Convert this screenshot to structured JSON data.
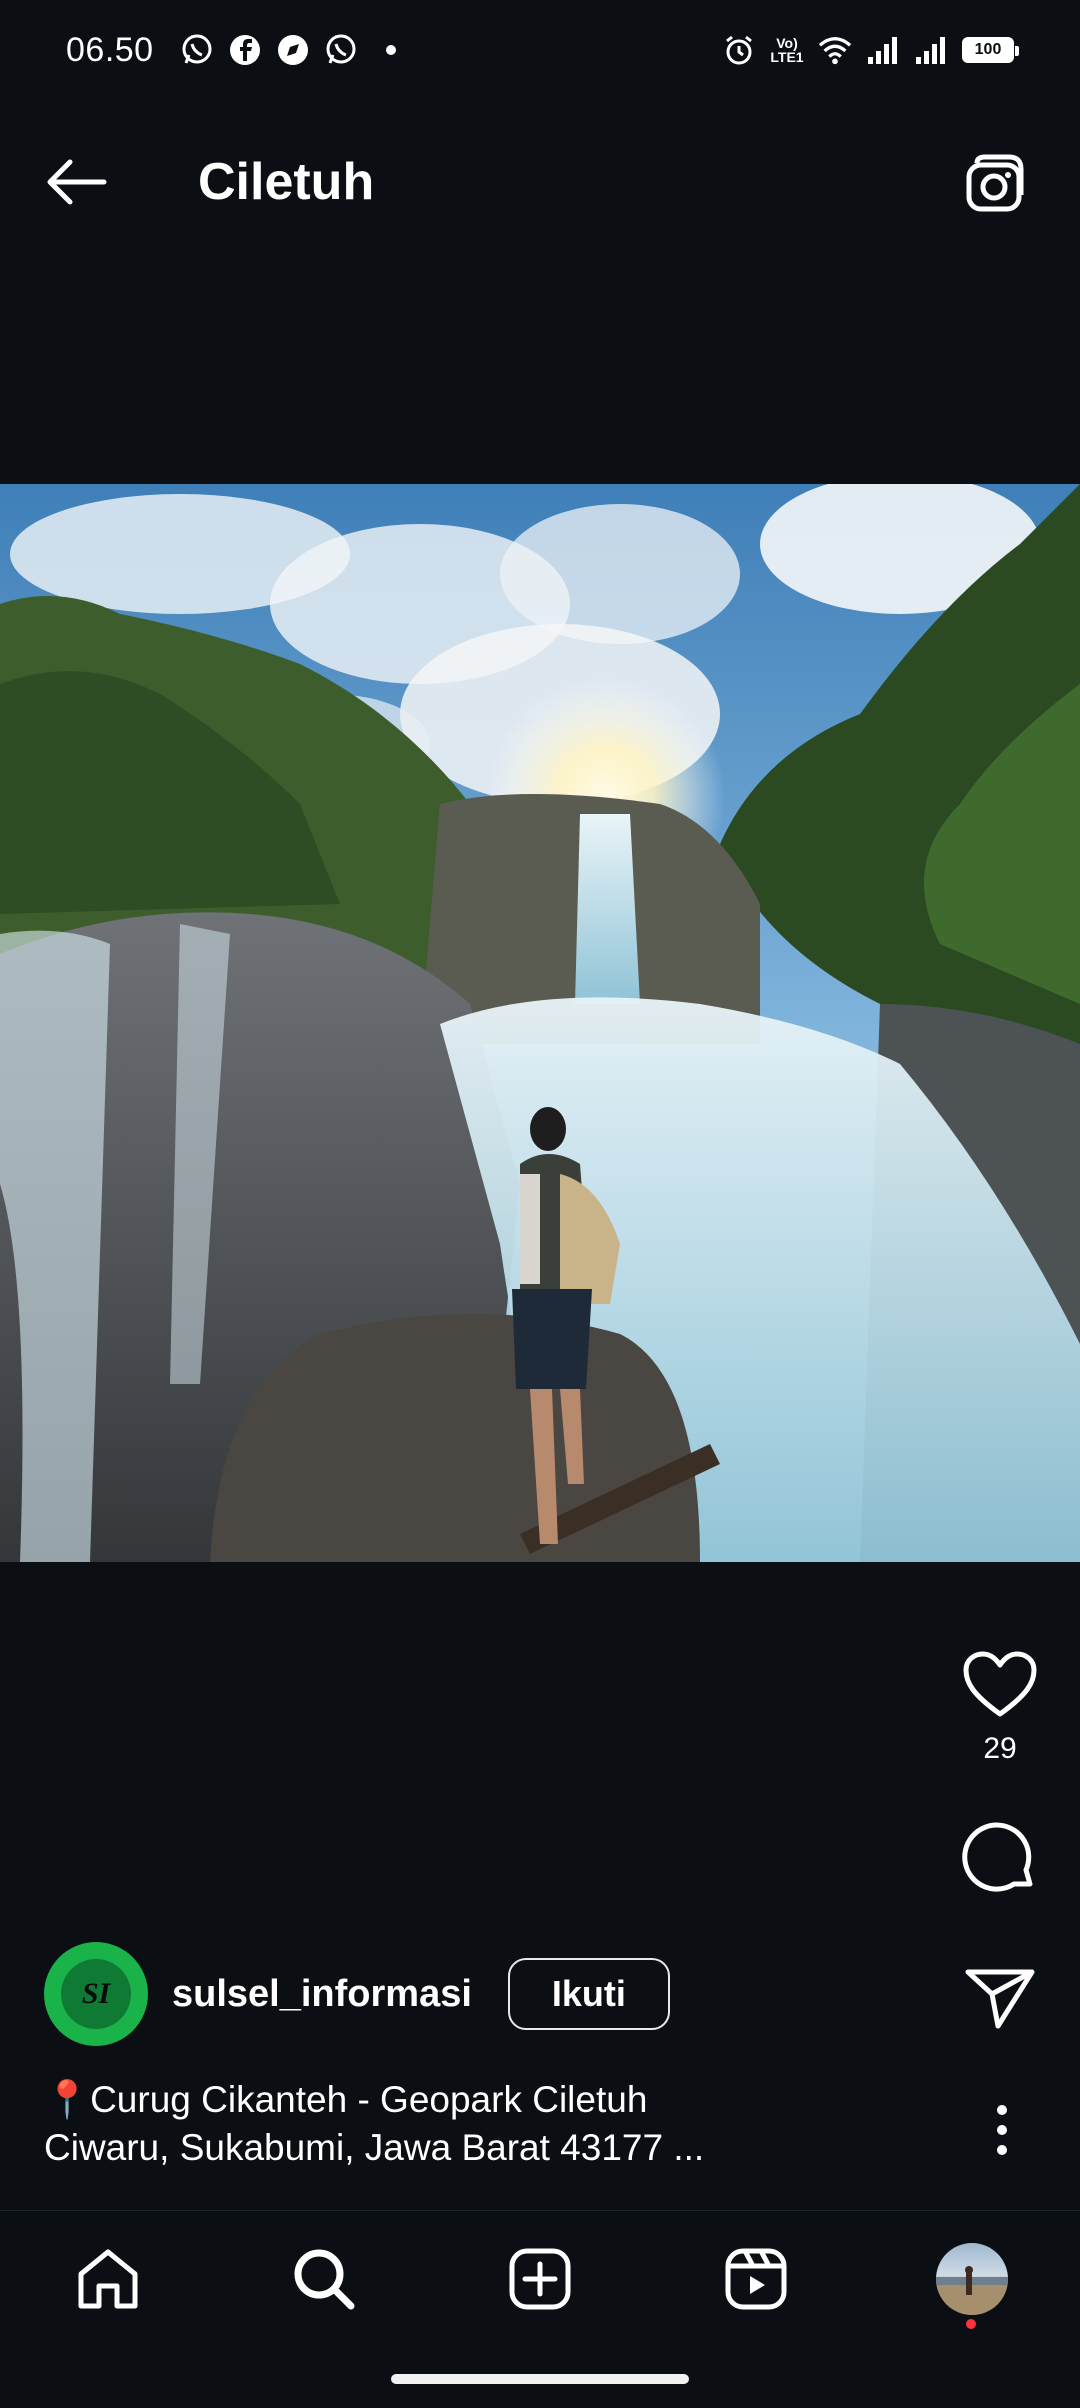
{
  "status_bar": {
    "time": "06.50",
    "left_icons": [
      "whatsapp-icon",
      "facebook-icon",
      "compass-app-icon",
      "whatsapp-icon"
    ],
    "lte_label_top": "Vo)",
    "lte_label_bottom": "LTE1",
    "battery": "100"
  },
  "header": {
    "title": "Ciletuh"
  },
  "post": {
    "like_count": "29",
    "author": {
      "username": "sulsel_informasi",
      "avatar_logo": "SI",
      "follow_label": "Ikuti"
    },
    "caption_line1": "Curug Cikanteh - Geopark Ciletuh",
    "caption_line2": "Ciwaru, Sukabumi, Jawa Barat 43177 ...",
    "pin_emoji": "📍"
  },
  "bottom_nav": {
    "items": [
      "home-icon",
      "search-icon",
      "create-post-icon",
      "reels-icon",
      "profile-avatar"
    ]
  }
}
